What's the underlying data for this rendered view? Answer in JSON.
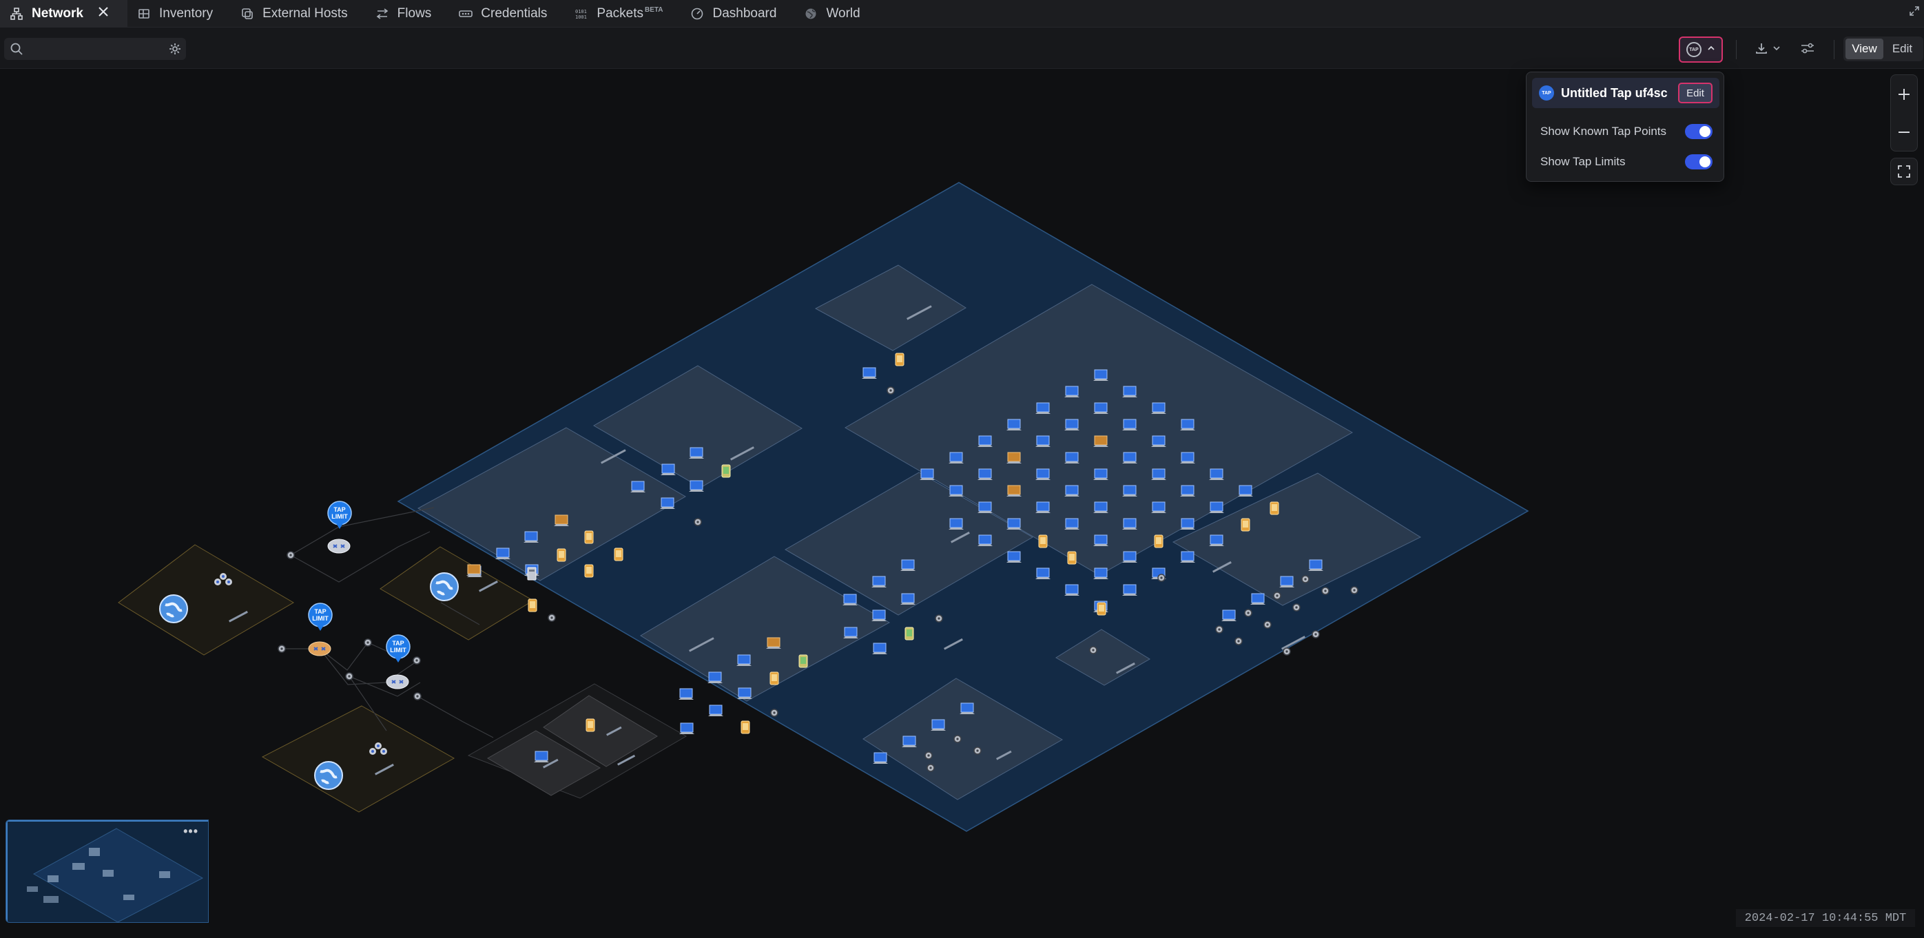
{
  "tabs": [
    {
      "label": "Network",
      "icon": "network-icon",
      "active": true
    },
    {
      "label": "Inventory",
      "icon": "inventory-icon"
    },
    {
      "label": "External Hosts",
      "icon": "external-hosts-icon"
    },
    {
      "label": "Flows",
      "icon": "flows-icon"
    },
    {
      "label": "Credentials",
      "icon": "credentials-icon"
    },
    {
      "label": "Packets",
      "badge": "BETA",
      "icon": "packets-icon"
    },
    {
      "label": "Dashboard",
      "icon": "dashboard-icon"
    },
    {
      "label": "World",
      "icon": "globe-icon"
    }
  ],
  "toolbar": {
    "search_placeholder": "",
    "tap_badge": "TAP",
    "view_label": "View",
    "edit_label": "Edit"
  },
  "tap_popover": {
    "tap_badge": "TAP",
    "tap_name": "Untitled Tap uf4sc",
    "edit_label": "Edit",
    "toggles": [
      {
        "label": "Show Known Tap Points",
        "on": true
      },
      {
        "label": "Show Tap Limits",
        "on": true
      }
    ]
  },
  "tap_limit_marker": {
    "line1": "TAP",
    "line2": "LIMIT"
  },
  "minimap": {
    "menu": "•••"
  },
  "timestamp": "2024-02-17 10:44:55 MDT",
  "colors": {
    "accent_blue": "#3557e6",
    "highlight_pink": "#d6336c",
    "network_fill": "#132a45",
    "external_fill": "#1c1a14"
  }
}
